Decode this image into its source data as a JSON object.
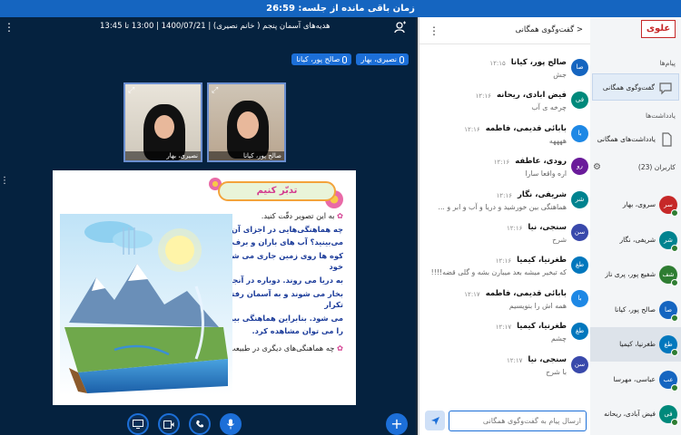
{
  "topbar": {
    "remaining_time": "زمان باقی مانده از جلسه: 26:59"
  },
  "meeting": {
    "title": "هدیه‌های آسمان پنجم ( خانم نصیری) | 1400/07/21 | 13:00 تا 13:45",
    "talkers": [
      "نصیری، بهار",
      "صالح پور، کیانا"
    ]
  },
  "videos": [
    {
      "name": "صالح پور، کیانا"
    },
    {
      "name": "نصیری، بهار"
    }
  ],
  "slide": {
    "heading": "تدبّر کنیم",
    "lines": [
      "به این تصویر دقّت کنید.",
      "چه هماهنگی‌هایی در اجزای آن",
      "می‌بینید؟ آب های باران و برف های آب شده ی",
      "کوه ها روی زمین جاری می شوند و در مسیر خود",
      "به دریا می روند. دوباره در آنجا با نور خورشید",
      "بخار می شوند و به آسمان رفته و این کار تکرار",
      "می شود. بنابراین هماهنگی بین زمین و آسمان",
      "را می توان مشاهده کرد."
    ],
    "question": "چه هماهنگی‌های دیگری در طبیعت سراغ دارید؟"
  },
  "chat": {
    "title": "گفت‌وگوی همگانی",
    "input_placeholder": "ارسال پیام به گفت‌وگوی همگانی",
    "messages": [
      {
        "initials": "صا",
        "color": "#1565c0",
        "name": "صالح پور، کیانا",
        "time": "۱۲:۱۵",
        "text": "جش"
      },
      {
        "initials": "فی",
        "color": "#00897b",
        "name": "فیض ابادی، ریحانه",
        "time": "۱۲:۱۶",
        "text": "چرخه ی آب"
      },
      {
        "initials": "با",
        "color": "#1e88e5",
        "name": "بابائی قدیمی، فاطمه",
        "time": "۱۲:۱۶",
        "text": "ههههه"
      },
      {
        "initials": "رو",
        "color": "#6a1b9a",
        "name": "رودی، عاطفه",
        "time": "۱۲:۱۶",
        "text": "اره واقعا سارا"
      },
      {
        "initials": "شر",
        "color": "#00838f",
        "name": "شریفی، نگار",
        "time": "۱۲:۱۶",
        "text": "هماهنگی بین خورشید و دریا و آب و ابر و ..."
      },
      {
        "initials": "سن",
        "color": "#3949ab",
        "name": "سنجی، نیا",
        "time": "۱۲:۱۶",
        "text": "شرح"
      },
      {
        "initials": "طغ",
        "color": "#0277bd",
        "name": "طغرنیا، کیمیا",
        "time": "۱۲:۱۶",
        "text": "که تبخیر میشه بعد میبارن بشه و گلی قضه!!!!"
      },
      {
        "initials": "با",
        "color": "#1e88e5",
        "name": "بابائی قدیمی، فاطمه",
        "time": "۱۲:۱۷",
        "text": "همه اش را بنویسیم"
      },
      {
        "initials": "طغ",
        "color": "#0277bd",
        "name": "طغرنیا، کیمیا",
        "time": "۱۲:۱۷",
        "text": "چشم"
      },
      {
        "initials": "سن",
        "color": "#3949ab",
        "name": "سنجی، نیا",
        "time": "۱۲:۱۷",
        "text": "با شرح"
      }
    ]
  },
  "sidebar": {
    "logo": "علوی",
    "messages_heading": "پیام‌ها",
    "public_chat_label": "گفت‌وگوی همگانی",
    "notes_heading": "یادداشت‌ها",
    "shared_notes_label": "یادداشت‌های همگانی",
    "users_heading": "کاربران (23)",
    "users": [
      {
        "initials": "سر",
        "color": "#c62828",
        "name": "سروی، بهار",
        "highlight": false
      },
      {
        "initials": "شر",
        "color": "#00838f",
        "name": "شریفی، نگار",
        "highlight": false
      },
      {
        "initials": "شف",
        "color": "#2e7d32",
        "name": "شفیع پور، پری ناز",
        "highlight": false
      },
      {
        "initials": "صا",
        "color": "#1565c0",
        "name": "صالح پور، کیانا",
        "highlight": false
      },
      {
        "initials": "طغ",
        "color": "#0277bd",
        "name": "طغرنیا، کیمیا",
        "highlight": true
      },
      {
        "initials": "عب",
        "color": "#1565c0",
        "name": "عباسی، مهرسا",
        "highlight": false
      },
      {
        "initials": "فی",
        "color": "#00897b",
        "name": "فیض آبادی، ریحانه",
        "highlight": false
      }
    ]
  }
}
